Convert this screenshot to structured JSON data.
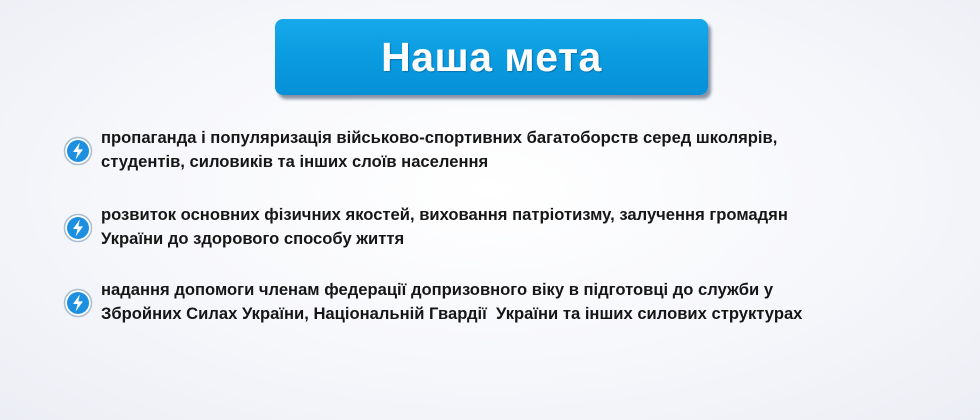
{
  "title": "Наша мета",
  "colors": {
    "banner": "#0a9adf",
    "icon_fill": "#1c8fe0",
    "text": "#161616"
  },
  "bullets": [
    {
      "icon": "lightning-bolt-icon",
      "line1": "пропаганда і популяризація військово-спортивних багатоборств серед школярів,",
      "line2": "студентів, силовиків та інших слоїв населення"
    },
    {
      "icon": "lightning-bolt-icon",
      "line1": "розвиток основних фізичних якостей, виховання патріотизму, залучення громадян",
      "line2": "України до здорового способу життя"
    },
    {
      "icon": "lightning-bolt-icon",
      "line1": "надання допомоги членам федерації допризовного віку в підготовці до служби у",
      "line2": "Збройних Силах України, Національній Гвардії  України та інших силових структурах"
    }
  ]
}
